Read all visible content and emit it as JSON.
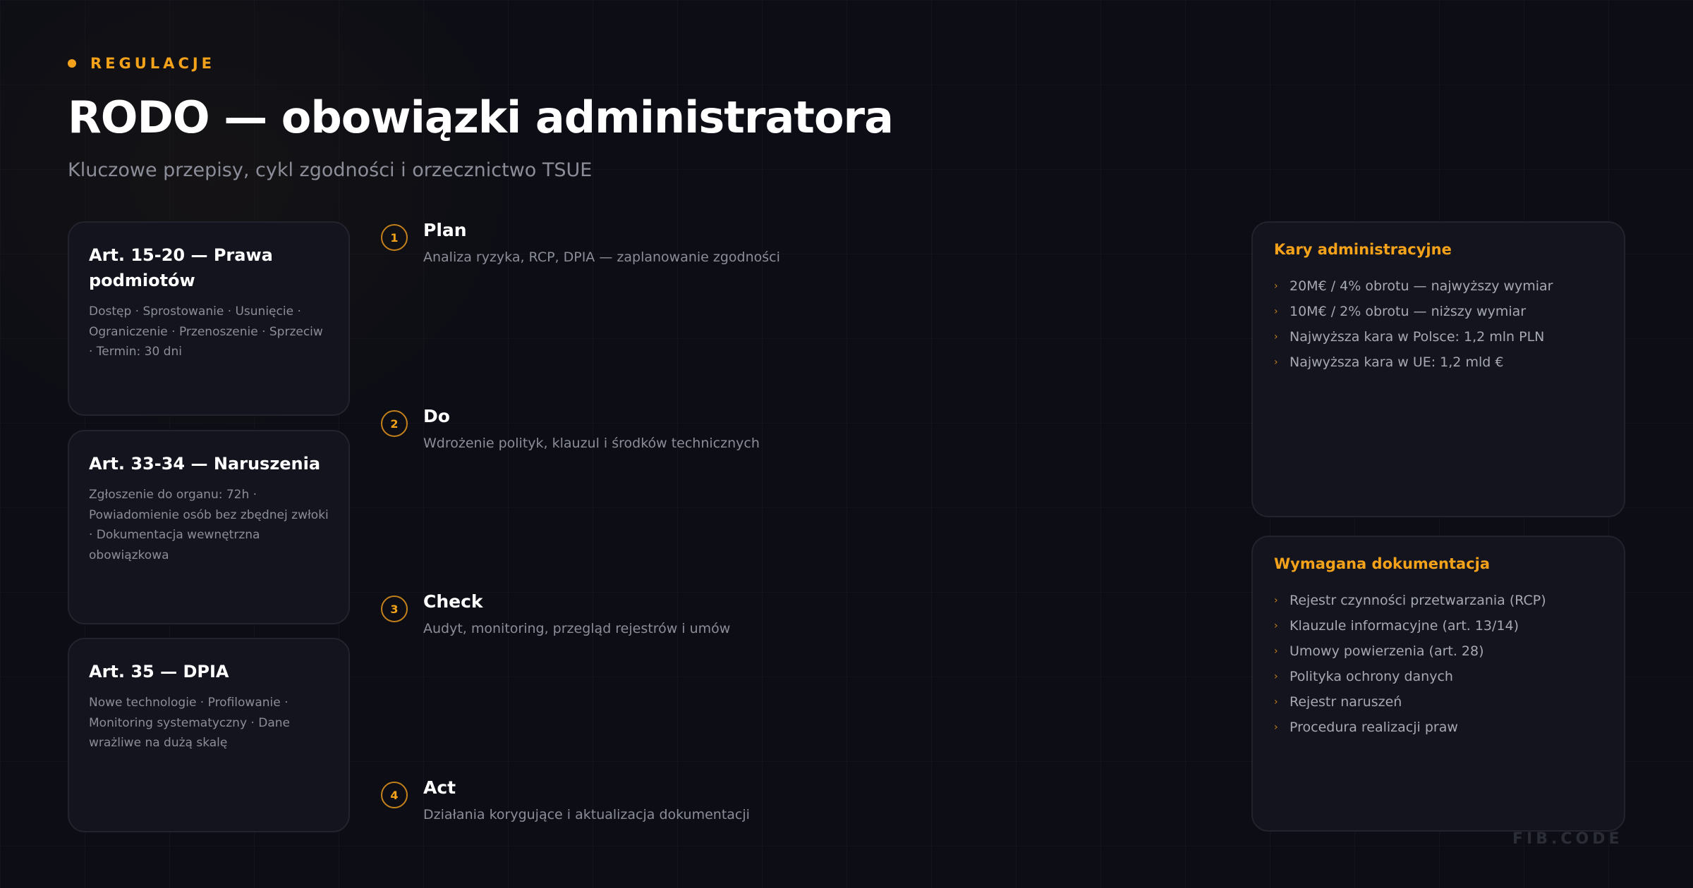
{
  "header": {
    "eyebrow": "REGULACJE",
    "title": "RODO — obowiązki administratora",
    "subtitle": "Kluczowe przepisy, cykl zgodności i orzecznictwo TSUE"
  },
  "articles": [
    {
      "title": "Art. 15-20 — Prawa podmiotów",
      "text": "Dostęp · Sprostowanie · Usunięcie · Ograniczenie · Przenoszenie · Sprzeciw · Termin: 30 dni"
    },
    {
      "title": "Art. 33-34 — Naruszenia",
      "text": "Zgłoszenie do organu: 72h · Powiadomienie osób bez zbędnej zwłoki · Dokumentacja wewnętrzna obowiązkowa"
    },
    {
      "title": "Art. 35 — DPIA",
      "text": "Nowe technologie · Profilowanie · Monitoring systematyczny · Dane wrażliwe na dużą skalę"
    }
  ],
  "cycle": [
    {
      "num": "1",
      "name": "Plan",
      "desc": "Analiza ryzyka, RCP, DPIA — zaplanowanie zgodności"
    },
    {
      "num": "2",
      "name": "Do",
      "desc": "Wdrożenie polityk, klauzul i środków technicznych"
    },
    {
      "num": "3",
      "name": "Check",
      "desc": "Audyt, monitoring, przegląd rejestrów i umów"
    },
    {
      "num": "4",
      "name": "Act",
      "desc": "Działania korygujące i aktualizacja dokumentacji"
    }
  ],
  "penalties": {
    "title": "Kary administracyjne",
    "items": [
      "20M€ / 4% obrotu — najwyższy wymiar",
      "10M€ / 2% obrotu — niższy wymiar",
      "Najwyższa kara w Polsce: 1,2 mln PLN",
      "Najwyższa kara w UE: 1,2 mld €"
    ]
  },
  "documentation": {
    "title": "Wymagana dokumentacja",
    "items": [
      "Rejestr czynności przetwarzania (RCP)",
      "Klauzule informacyjne (art. 13/14)",
      "Umowy powierzenia (art. 28)",
      "Polityka ochrony danych",
      "Rejestr naruszeń",
      "Procedura realizacji praw"
    ]
  },
  "brand": "FIB.CODE",
  "icons": {
    "bullet": "chevron-right-icon",
    "eyebrow": "dot-icon"
  },
  "colors": {
    "accent": "#f5a21b",
    "background": "#0c0d15",
    "card": "#13141d"
  }
}
